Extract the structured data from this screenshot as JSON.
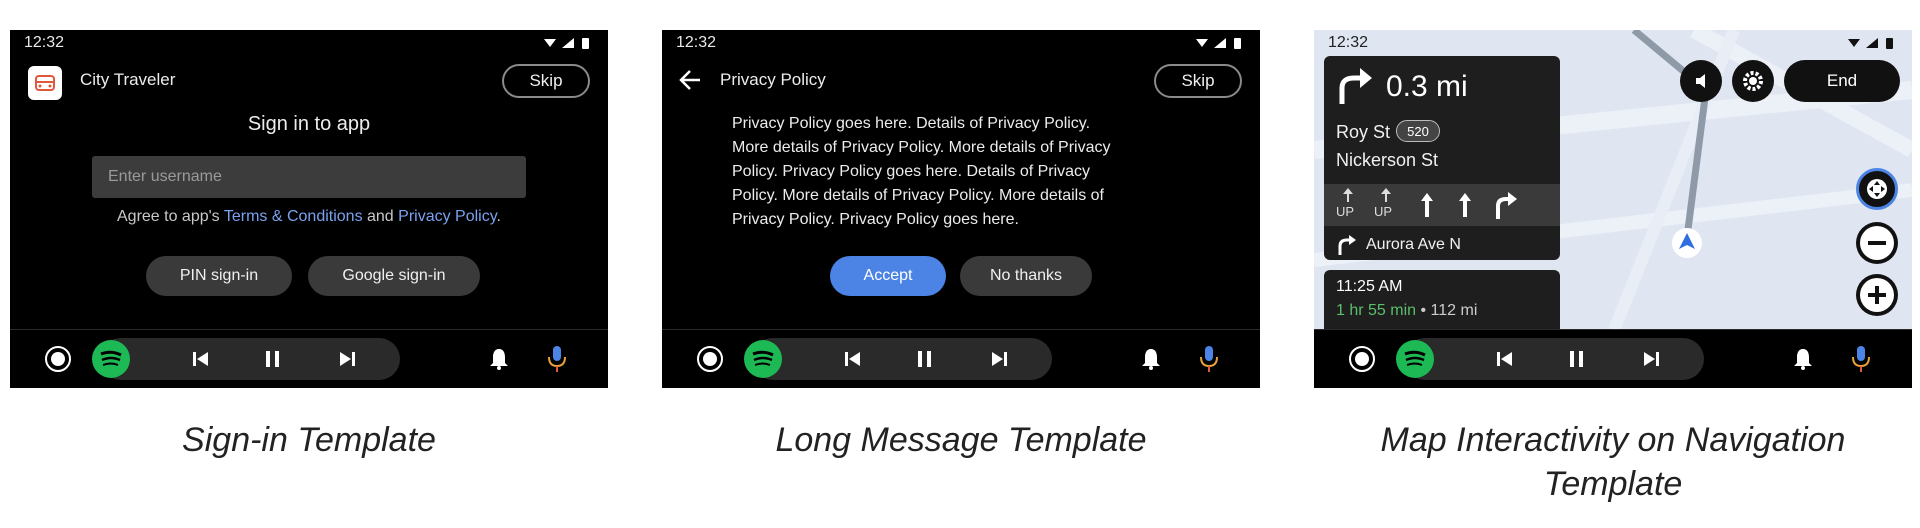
{
  "status": {
    "time": "12:32"
  },
  "signin": {
    "app_title": "City Traveler",
    "skip": "Skip",
    "heading": "Sign in to app",
    "username_placeholder": "Enter username",
    "agree_prefix": "Agree to app's ",
    "terms_link": "Terms & Conditions",
    "and": " and ",
    "privacy_link": "Privacy Policy",
    "period": ".",
    "pin_button": "PIN sign-in",
    "google_button": "Google sign-in",
    "caption": "Sign-in Template"
  },
  "longmsg": {
    "title": "Privacy Policy",
    "skip": "Skip",
    "message_lines": [
      "Privacy Policy goes here. Details of Privacy Policy.",
      "More details of Privacy Policy. More details of Privacy",
      "Policy. Privacy Policy goes here. Details of Privacy",
      "Policy. More details of Privacy Policy. More details of",
      "Privacy Policy. Privacy Policy goes here."
    ],
    "accept": "Accept",
    "no_thanks": "No thanks",
    "caption": "Long Message Template"
  },
  "nav": {
    "distance": "0.3 mi",
    "street1": "Roy St",
    "route_badge": "520",
    "street2": "Nickerson St",
    "lane_labels": [
      "UP",
      "UP"
    ],
    "next_step": "Aurora Ave N",
    "eta_time": "11:25 AM",
    "eta_duration": "1 hr 55 min",
    "eta_sep": " • ",
    "eta_distance": "112 mi",
    "end_button": "End",
    "caption": "Map Interactivity on Navigation Template"
  },
  "colors": {
    "accent_blue": "#4c84e6",
    "link": "#7aa2f0",
    "spotify_green": "#1db954",
    "map_bg": "#dfe6f2"
  }
}
